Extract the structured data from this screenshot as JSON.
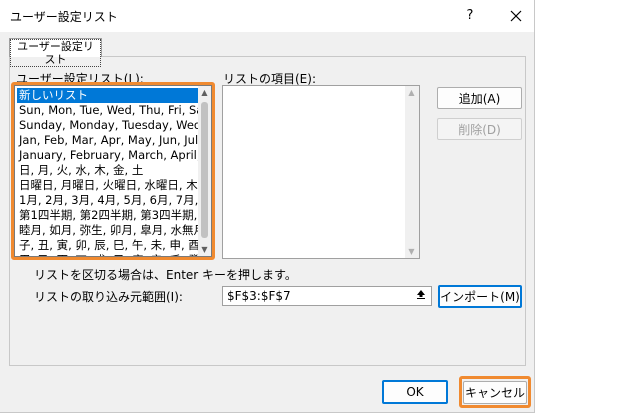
{
  "window": {
    "title": "ユーザー設定リスト",
    "help_label": "?"
  },
  "tab": {
    "label": "ユーザー設定リスト"
  },
  "custom_lists": {
    "label": "ユーザー設定リスト(L):",
    "items": [
      "新しいリスト",
      "Sun, Mon, Tue, Wed, Thu, Fri, Sat",
      "Sunday, Monday, Tuesday, Wedn",
      "Jan, Feb, Mar, Apr, May, Jun, Jul,",
      "January, February, March, April,",
      "日, 月, 火, 水, 木, 金, 土",
      "日曜日, 月曜日, 火曜日, 水曜日, 木",
      "1月, 2月, 3月, 4月, 5月, 6月, 7月,",
      "第1四半期, 第2四半期, 第3四半期,",
      "睦月, 如月, 弥生, 卯月, 皐月, 水無月",
      "子, 丑, 寅, 卯, 辰, 巳, 午, 未, 申, 酉",
      "甲, 乙, 丙, 丁, 戊, 己, 庚, 辛, 壬, 癸"
    ],
    "selected_index": 0
  },
  "list_entries": {
    "label": "リストの項目(E):"
  },
  "buttons": {
    "add": "追加(A)",
    "delete": "削除(D)",
    "import": "インポート(M)",
    "ok": "OK",
    "cancel": "キャンセル"
  },
  "hint": "リストを区切る場合は、Enter キーを押します。",
  "import_range": {
    "label": "リストの取り込み元範囲(I):",
    "value": "$F$3:$F$7"
  },
  "colors": {
    "highlight": "#f08a30",
    "selection": "#0078d7"
  }
}
